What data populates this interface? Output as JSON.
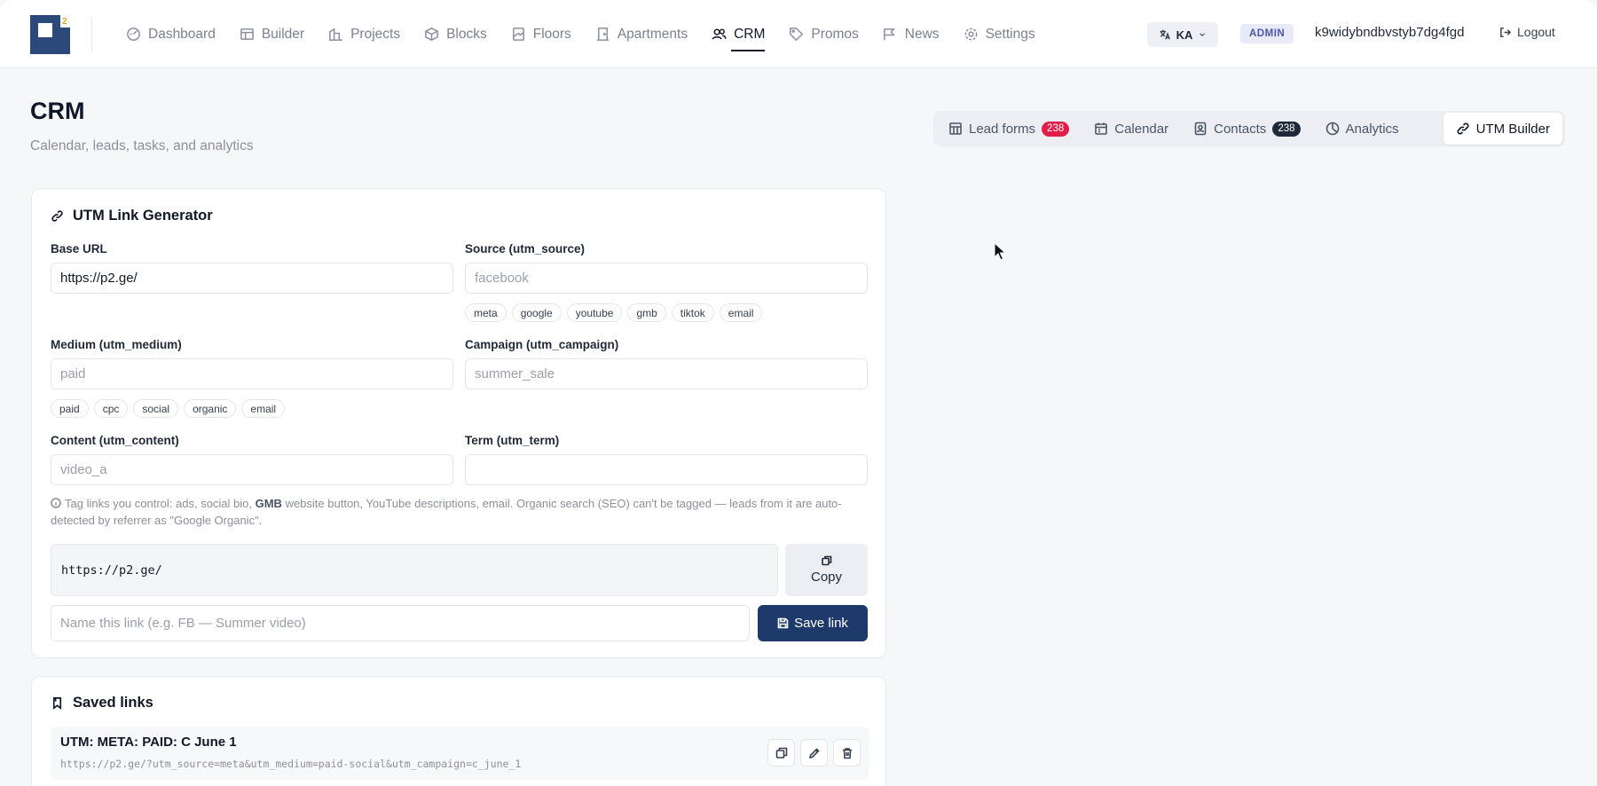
{
  "nav": {
    "items": [
      {
        "label": "Dashboard",
        "icon": "dashboard-icon"
      },
      {
        "label": "Builder",
        "icon": "builder-icon"
      },
      {
        "label": "Projects",
        "icon": "projects-icon"
      },
      {
        "label": "Blocks",
        "icon": "blocks-icon"
      },
      {
        "label": "Floors",
        "icon": "floors-icon"
      },
      {
        "label": "Apartments",
        "icon": "apartments-icon"
      },
      {
        "label": "CRM",
        "icon": "crm-icon",
        "active": true
      },
      {
        "label": "Promos",
        "icon": "tag-icon"
      },
      {
        "label": "News",
        "icon": "news-icon"
      },
      {
        "label": "Settings",
        "icon": "gear-icon"
      }
    ],
    "language": "KA",
    "role_badge": "ADMIN",
    "username": "k9widybndbvstyb7dg4fgd",
    "logout_label": "Logout"
  },
  "header": {
    "title": "CRM",
    "subtitle": "Calendar, leads, tasks, and analytics"
  },
  "tabs": [
    {
      "label": "Lead forms",
      "count": "238",
      "active": false
    },
    {
      "label": "Calendar",
      "active": false
    },
    {
      "label": "Contacts",
      "count": "238",
      "active": false
    },
    {
      "label": "Analytics",
      "active": false
    },
    {
      "label": "UTM Builder",
      "active": true
    }
  ],
  "generator": {
    "title": "UTM Link Generator",
    "base_url": {
      "label": "Base URL",
      "value": "https://p2.ge/"
    },
    "source": {
      "label": "Source (utm_source)",
      "placeholder": "facebook",
      "chips": [
        "meta",
        "google",
        "youtube",
        "gmb",
        "tiktok",
        "email"
      ]
    },
    "medium": {
      "label": "Medium (utm_medium)",
      "placeholder": "paid",
      "chips": [
        "paid",
        "cpc",
        "social",
        "organic",
        "email"
      ]
    },
    "campaign": {
      "label": "Campaign (utm_campaign)",
      "placeholder": "summer_sale"
    },
    "content": {
      "label": "Content (utm_content)",
      "placeholder": "video_a"
    },
    "term": {
      "label": "Term (utm_term)",
      "placeholder": ""
    },
    "hint_before": "Tag links you control: ads, social bio, ",
    "hint_bold": "GMB",
    "hint_after": " website button, YouTube descriptions, email. Organic search (SEO) can't be tagged — leads from it are auto-detected by referrer as \"Google Organic\".",
    "preview_url": "https://p2.ge/",
    "copy_label": "Copy",
    "name_placeholder": "Name this link (e.g. FB — Summer video)",
    "save_label": "Save link"
  },
  "saved": {
    "title": "Saved links",
    "items": [
      {
        "name": "UTM: META: PAID: C June 1",
        "url": "https://p2.ge/?utm_source=meta&utm_medium=paid-social&utm_campaign=c_june_1"
      }
    ]
  }
}
